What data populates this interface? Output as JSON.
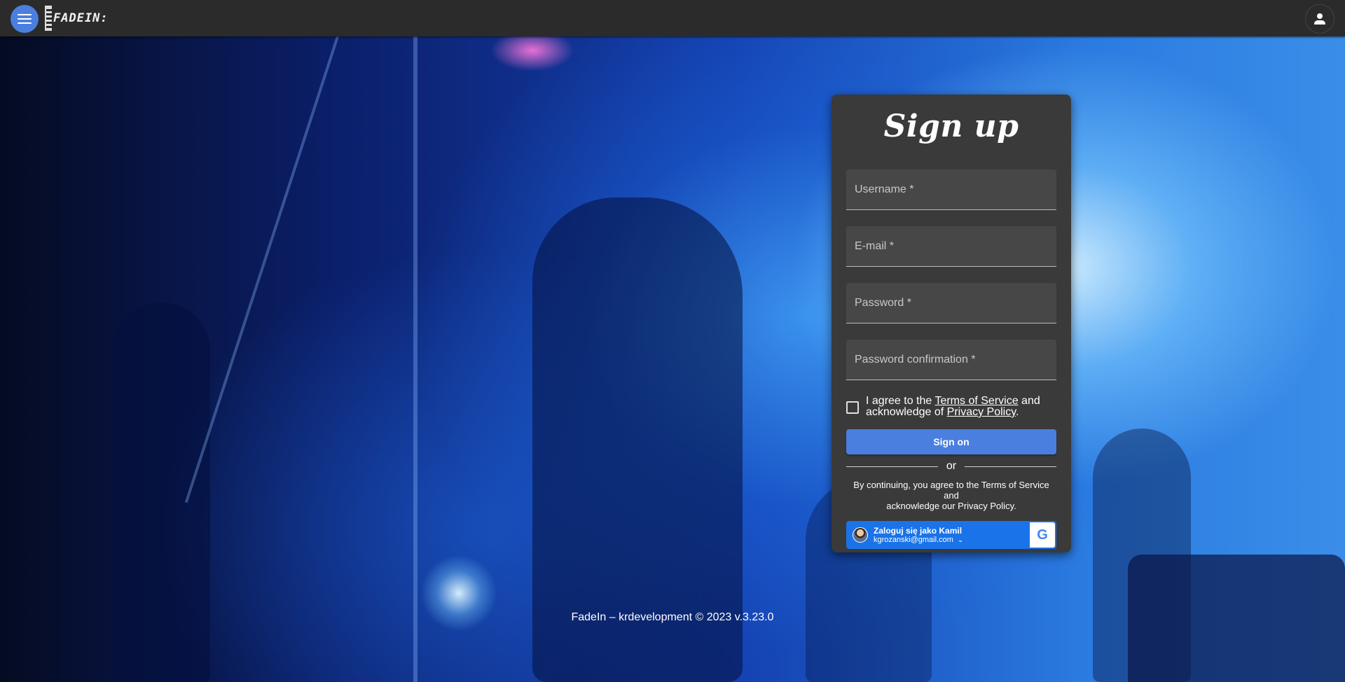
{
  "header": {
    "logo_text": "FADEIN:",
    "menu_icon": "menu-icon",
    "account_icon": "person-icon"
  },
  "form": {
    "title": "Sign up",
    "username_placeholder": "Username *",
    "email_placeholder": "E-mail *",
    "password_placeholder": "Password *",
    "password_confirmation_placeholder": "Password confirmation *",
    "agree_prefix": "I agree to the ",
    "terms_link": "Terms of Service",
    "agree_middle": " and acknowledge of ",
    "privacy_link": "Privacy Policy",
    "agree_suffix": ".",
    "submit_label": "Sign on",
    "or_label": "or",
    "legal_line1": "By continuing, you agree to the Terms of Service and",
    "legal_line2_prefix": "acknowledge our ",
    "legal_privacy": "Privacy Policy",
    "legal_line2_suffix": "."
  },
  "google": {
    "name_label": "Zaloguj się jako Kamil",
    "email": "kgrozanski@gmail.com",
    "chevron": "⌄",
    "g_letter": "G"
  },
  "footer": {
    "text": "FadeIn – krdevelopment © 2023 v.3.23.0"
  },
  "colors": {
    "accent": "#4a7fe0",
    "topbar": "#2b2b2b",
    "card": "#3a3a3a",
    "google_blue": "#1a73e8"
  }
}
